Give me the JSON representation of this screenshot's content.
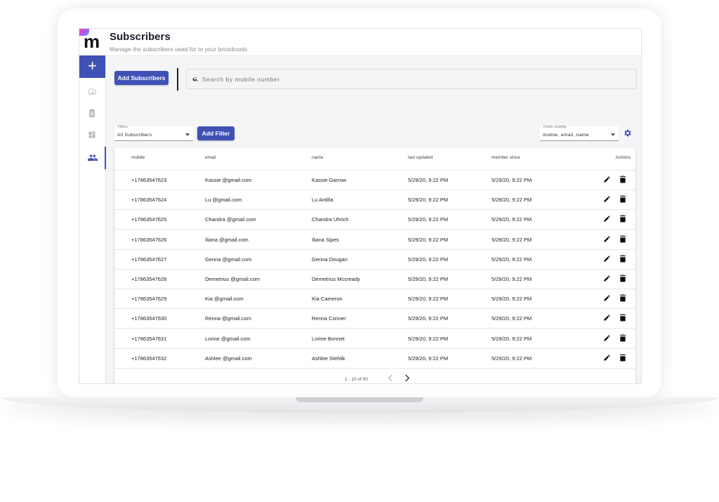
{
  "app": {
    "logo": "m",
    "title": "Subscribers",
    "subtitle": "Manage the subscribers used for to your broadcasts"
  },
  "sidebar": {
    "add_icon": "plus-icon",
    "items": [
      {
        "icon": "speedometer-icon"
      },
      {
        "icon": "clipboard-icon"
      },
      {
        "icon": "dashboard-icon"
      },
      {
        "icon": "people-icon"
      }
    ]
  },
  "toolbar": {
    "add_subscribers_label": "Add Subscribers",
    "search_placeholder": "Search by mobile number",
    "filters_label": "Filters",
    "filters_value": "All Subscribers",
    "add_filter_label": "Add Filter",
    "fields_visibility_label": "Fields Visibility",
    "fields_visibility_value": "mobile, email, name"
  },
  "table": {
    "headers": {
      "mobile": "mobile",
      "email": "email",
      "name": "name",
      "last_updated": "last updated",
      "member_since": "member since",
      "actions": "Actions"
    },
    "rows": [
      {
        "mobile": "+17863547623",
        "email": "Kassie @gmail.com",
        "name": "Kassie Garrow",
        "last_updated": "5/29/20, 9:22 PM",
        "member_since": "5/29/20, 9:22 PM"
      },
      {
        "mobile": "+17863547624",
        "email": "Lu @gmail.com",
        "name": "Lu Antilla",
        "last_updated": "5/29/20, 9:22 PM",
        "member_since": "5/29/20, 9:22 PM"
      },
      {
        "mobile": "+17863547625",
        "email": "Chandra @gmail.com",
        "name": "Chandra Uhrich",
        "last_updated": "5/29/20, 9:22 PM",
        "member_since": "5/29/20, 9:22 PM"
      },
      {
        "mobile": "+17863547626",
        "email": "Iliana @gmail.com",
        "name": "Iliana Sipes",
        "last_updated": "5/29/20, 9:22 PM",
        "member_since": "5/29/20, 9:22 PM"
      },
      {
        "mobile": "+17863547627",
        "email": "Genna @gmail.com",
        "name": "Genna Dougan",
        "last_updated": "5/29/20, 9:22 PM",
        "member_since": "5/29/20, 9:22 PM"
      },
      {
        "mobile": "+17863547628",
        "email": "Demetrius @gmail.com",
        "name": "Demetrius Mccready",
        "last_updated": "5/29/20, 9:22 PM",
        "member_since": "5/29/20, 9:22 PM"
      },
      {
        "mobile": "+17863547629",
        "email": "Kia @gmail.com",
        "name": "Kia Cameron",
        "last_updated": "5/29/20, 9:22 PM",
        "member_since": "5/29/20, 9:22 PM"
      },
      {
        "mobile": "+17863547630",
        "email": "Renna @gmail.com",
        "name": "Renna Conner",
        "last_updated": "5/29/20, 9:22 PM",
        "member_since": "5/29/20, 9:22 PM"
      },
      {
        "mobile": "+17863547631",
        "email": "Lorine @gmail.com",
        "name": "Lorine Bonnet",
        "last_updated": "5/29/20, 9:22 PM",
        "member_since": "5/29/20, 9:22 PM"
      },
      {
        "mobile": "+17863547632",
        "email": "Ashlee @gmail.com",
        "name": "Ashlee Stehlik",
        "last_updated": "5/29/20, 9:22 PM",
        "member_since": "5/29/20, 9:22 PM"
      }
    ],
    "row_actions": {
      "edit_icon": "pencil-icon",
      "delete_icon": "trash-icon"
    }
  },
  "pagination": {
    "range": "1 - 10 of 50",
    "prev_icon": "chevron-left-icon",
    "next_icon": "chevron-right-icon"
  },
  "colors": {
    "accent": "#3f51b5",
    "background": "#f5f5f7",
    "sidebar_icon": "#b5b5bd"
  }
}
